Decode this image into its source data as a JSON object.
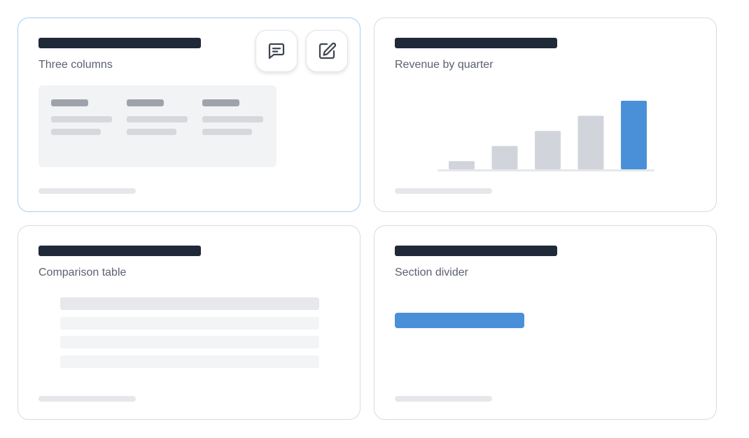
{
  "cards": [
    {
      "label": "Three columns",
      "selected": true
    },
    {
      "label": "Revenue by quarter",
      "selected": false
    },
    {
      "label": "Comparison table",
      "selected": false
    },
    {
      "label": "Section divider",
      "selected": false
    }
  ],
  "actions": {
    "comment_icon": "comment-icon",
    "edit_icon": "edit-icon"
  },
  "three_columns": {
    "column_count": 3
  },
  "chart_data": {
    "type": "bar",
    "categories": [
      "",
      "",
      "",
      "",
      ""
    ],
    "values": [
      12,
      34,
      56,
      78,
      100
    ],
    "highlight_index": 4,
    "ylim": [
      0,
      100
    ],
    "colors": {
      "bar": "#d1d5db",
      "highlight": "#4a90d9",
      "baseline": "#e5e7eb"
    }
  },
  "comparison_table": {
    "row_count": 4
  },
  "colors": {
    "title_bar": "#1f2937",
    "accent": "#4a90d9",
    "selected_border": "#a9cdf1"
  }
}
